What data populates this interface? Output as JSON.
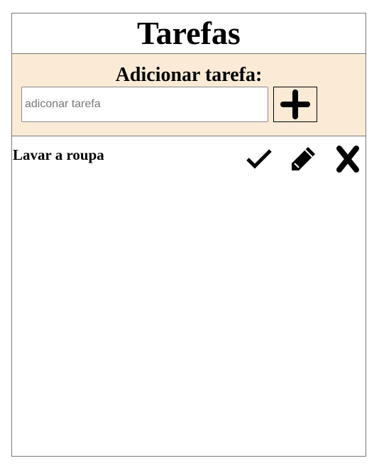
{
  "header": {
    "title": "Tarefas"
  },
  "add_panel": {
    "heading": "Adicionar tarefa:",
    "input_placeholder": "adiconar tarefa",
    "input_value": "",
    "add_button_icon": "plus-icon"
  },
  "tasks": [
    {
      "label": "Lavar a roupa",
      "actions": [
        "check-icon",
        "pencil-icon",
        "x-icon"
      ]
    }
  ],
  "colors": {
    "panel_background": "#fbebd6",
    "border": "#7a7a7a",
    "text": "#000000"
  }
}
